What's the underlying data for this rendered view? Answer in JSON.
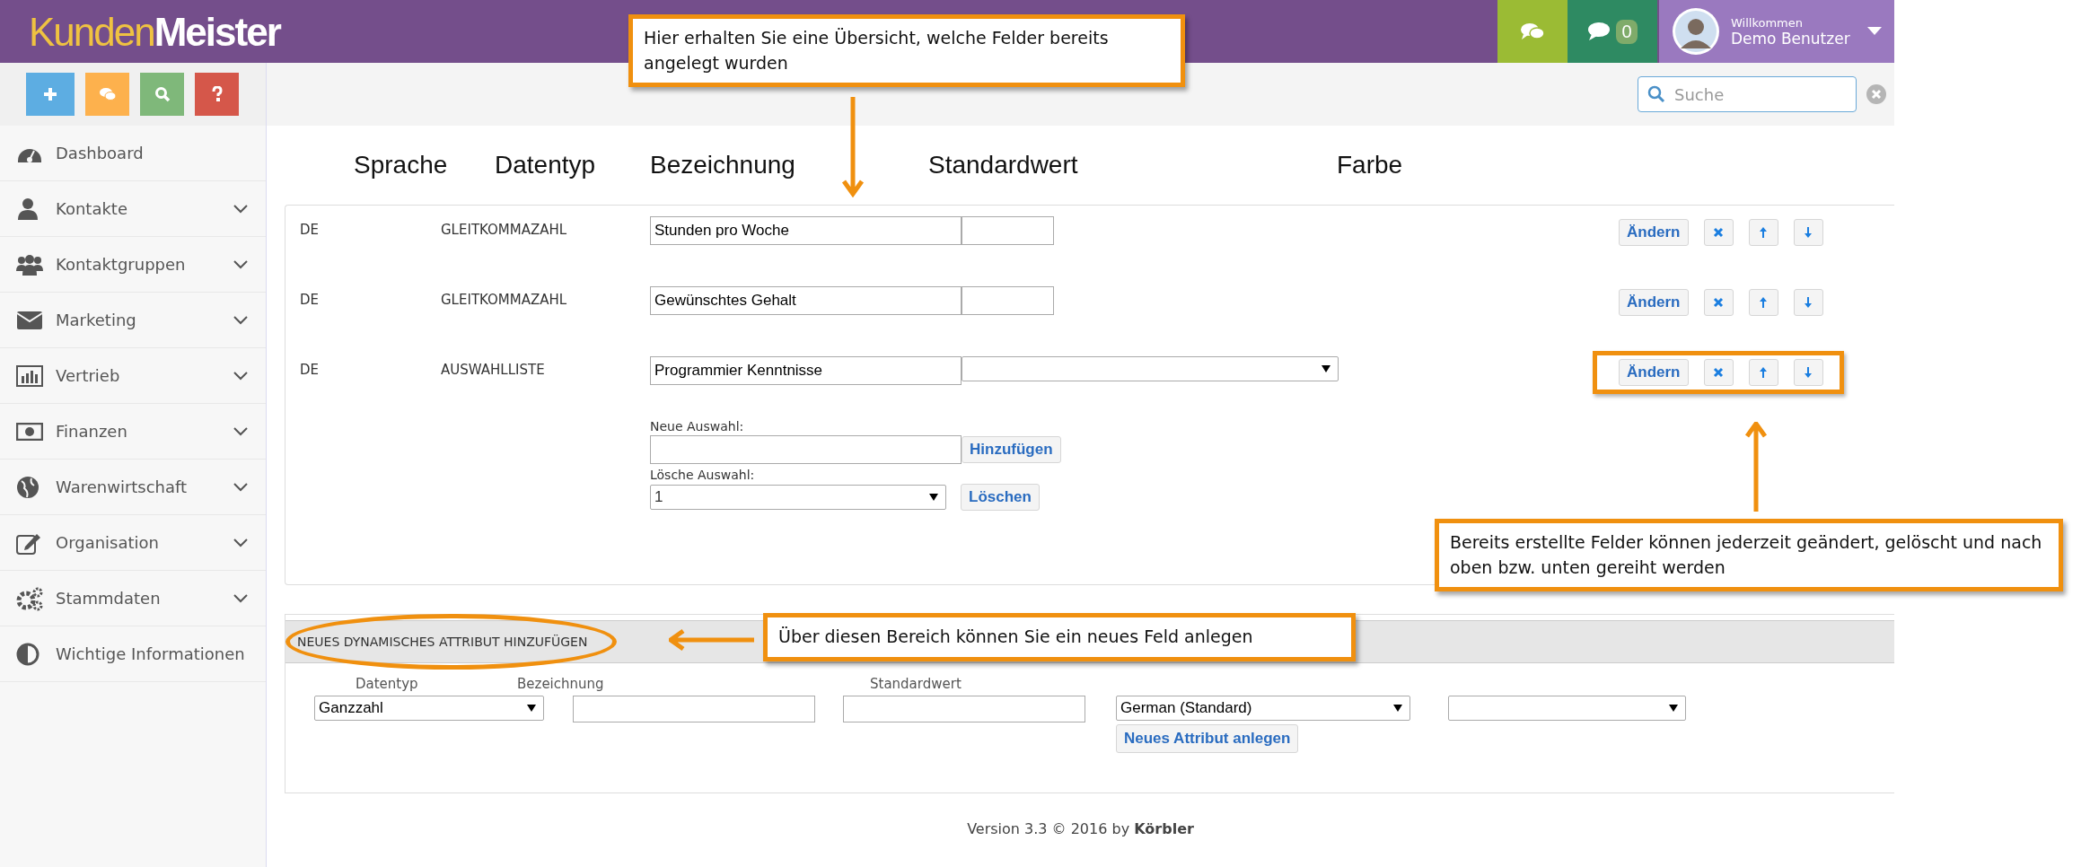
{
  "header": {
    "logo_first": "Kunden",
    "logo_second": "Meister",
    "messages_count": "0",
    "welcome": "Willkommen",
    "user_name": "Demo Benutzer"
  },
  "quick_buttons": [
    {
      "color": "#5dade2"
    },
    {
      "color": "#fdb14d"
    },
    {
      "color": "#7fb87a"
    },
    {
      "color": "#d5574a"
    }
  ],
  "search": {
    "placeholder": "Suche"
  },
  "sidebar": {
    "items": [
      {
        "label": "Dashboard",
        "expandable": false
      },
      {
        "label": "Kontakte",
        "expandable": true
      },
      {
        "label": "Kontaktgruppen",
        "expandable": true
      },
      {
        "label": "Marketing",
        "expandable": true
      },
      {
        "label": "Vertrieb",
        "expandable": true
      },
      {
        "label": "Finanzen",
        "expandable": true
      },
      {
        "label": "Warenwirtschaft",
        "expandable": true
      },
      {
        "label": "Organisation",
        "expandable": true
      },
      {
        "label": "Stammdaten",
        "expandable": true
      },
      {
        "label": "Wichtige Informationen",
        "expandable": false
      }
    ]
  },
  "table": {
    "columns": [
      "Sprache",
      "Datentyp",
      "Bezeichnung",
      "Standardwert",
      "Farbe"
    ],
    "rows": [
      {
        "language": "DE",
        "datatype": "GLEITKOMMAZAHL",
        "name": "Stunden pro Woche",
        "kind": "value",
        "edit_button": "Ändern",
        "highlighted": false
      },
      {
        "language": "DE",
        "datatype": "GLEITKOMMAZAHL",
        "name": "Gewünschtes Gehalt",
        "kind": "value",
        "edit_button": "Ändern",
        "highlighted": false
      },
      {
        "language": "DE",
        "datatype": "AUSWAHLLISTE",
        "name": "Programmier Kenntnisse",
        "kind": "list",
        "edit_button": "Ändern",
        "highlighted": true,
        "list_editor": {
          "new_label": "Neue Auswahl:",
          "add_button": "Hinzufügen",
          "delete_label": "Lösche Auswahl:",
          "delete_value": "1",
          "delete_button": "Löschen"
        }
      }
    ]
  },
  "new_attribute": {
    "title": "NEUES DYNAMISCHES ATTRIBUT HINZUFÜGEN",
    "labels": [
      "Datentyp",
      "Bezeichnung",
      "Standardwert"
    ],
    "datatype_value": "Ganzzahl",
    "language_value": "German (Standard)",
    "submit_button": "Neues Attribut anlegen",
    "title_circled": true
  },
  "footer": "Version 3.3 © 2016 by **Körbler**",
  "annotations": [
    {
      "text": "Hier erhalten Sie eine Übersicht, welche Felder bereits angelegt wurden"
    },
    {
      "text": "Bereits erstellte Felder können jederzeit geändert, gelöscht und nach oben bzw. unten gereiht werden"
    },
    {
      "text": "Über diesen Bereich können Sie ein neues Feld anlegen"
    }
  ]
}
